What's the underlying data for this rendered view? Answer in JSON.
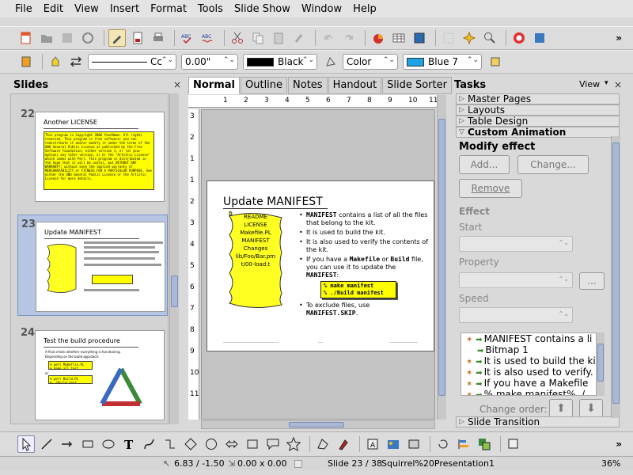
{
  "menu": [
    "File",
    "Edit",
    "View",
    "Insert",
    "Format",
    "Tools",
    "Slide Show",
    "Window",
    "Help"
  ],
  "line_format": {
    "line_style": "Cc",
    "line_width": "0.00\"",
    "line_color": "Black",
    "area_style": "Color",
    "area_color": "Blue 7",
    "line_color_hex": "#000000",
    "area_color_hex": "#1da2e6"
  },
  "slides_pane": {
    "title": "Slides",
    "close": "×",
    "slides": [
      {
        "number": "22",
        "title": "Another LICENSE",
        "box_text": "This program is Copyright 2006 YourName. All rights reserved. This program is free software; you can redistribute it and/or modify it under the terms of the GNU General Public License as published by the Free Software Foundation; either version 1, or (at your option) any later version, or b) the \"Artistic License\" which comes with Perl. This program is distributed in the hope that it will be useful, but WITHOUT ANY WARRANTY; without even the implied warranty of MERCHANTABILITY or FITNESS FOR A PARTICULAR PURPOSE. See either the GNU General Public License or the Artistic License for more details."
      },
      {
        "number": "23",
        "title": "Update MANIFEST",
        "selected": true
      },
      {
        "number": "24",
        "title": "Test the build procedure",
        "bullets": [
          "A final check whether everything is functioning.",
          "Depending on the build approach:"
        ],
        "box1": "% perl Makefile.PL\n% make all test",
        "or": "or",
        "box2": "% perl Build.PL\n% ./Build test"
      }
    ]
  },
  "view_tabs": [
    "Normal",
    "Outline",
    "Notes",
    "Handout",
    "Slide Sorter"
  ],
  "ruler_numbers": [
    "1",
    "2",
    "3",
    "4",
    "5",
    "6",
    "7",
    "8",
    "9",
    "10",
    "11"
  ],
  "vruler_numbers": [
    "3",
    "2",
    "1",
    "1",
    "2",
    "3",
    "4",
    "5",
    "6",
    "7",
    "8",
    "9",
    "10",
    "11"
  ],
  "slide": {
    "title": "Update MANIFEST",
    "scroll_lines": [
      "README",
      "LICENSE",
      "Makefile.PL",
      "MANIFEST",
      "Changes",
      "lib/Foo/Bar.pm",
      "t/00-load.t"
    ],
    "bullet1_code": "MANIFEST",
    "bullet1_text": " contains a list of all the files that belong to the kit.",
    "bullet2": "It is used to build the kit.",
    "bullet3": "It is also used to verify the contents of the kit.",
    "bullet4_a": "If you have a ",
    "bullet4_code1": "Makefile",
    "bullet4_b": " or ",
    "bullet4_code2": "Build",
    "bullet4_c": " file, you can use it to update the ",
    "bullet4_code3": "MANIFEST",
    "bullet4_d": ":",
    "cmd1": "% make manifest",
    "cmd2": "% ./Build manifest",
    "bullet5_text": "To exclude files, use",
    "bullet5_code": "MANIFEST.SKIP",
    "bullet5_end": "."
  },
  "tasks": {
    "title": "Tasks",
    "view_label": "View",
    "close": "×",
    "sections": [
      "Master Pages",
      "Layouts",
      "Table Design",
      "Custom Animation"
    ],
    "modify_effect": "Modify effect",
    "add": "Add...",
    "change": "Change...",
    "remove": "Remove",
    "effect": "Effect",
    "start": "Start",
    "property": "Property",
    "property_btn": "...",
    "speed": "Speed",
    "effects": [
      "MANIFEST contains a li",
      "Bitmap 1",
      "It is used to build the ki",
      "It is also used to verify.",
      "If you have a Makefile",
      "% make manifest% ./..."
    ],
    "change_order": "Change order:",
    "slide_transition": "Slide Transition"
  },
  "status": {
    "position": "6.83 / -1.50",
    "size": "0.00 x 0.00",
    "slide": "Slide 23 / 38",
    "master": "Squirrel%20Presentation1",
    "zoom": "36%"
  }
}
